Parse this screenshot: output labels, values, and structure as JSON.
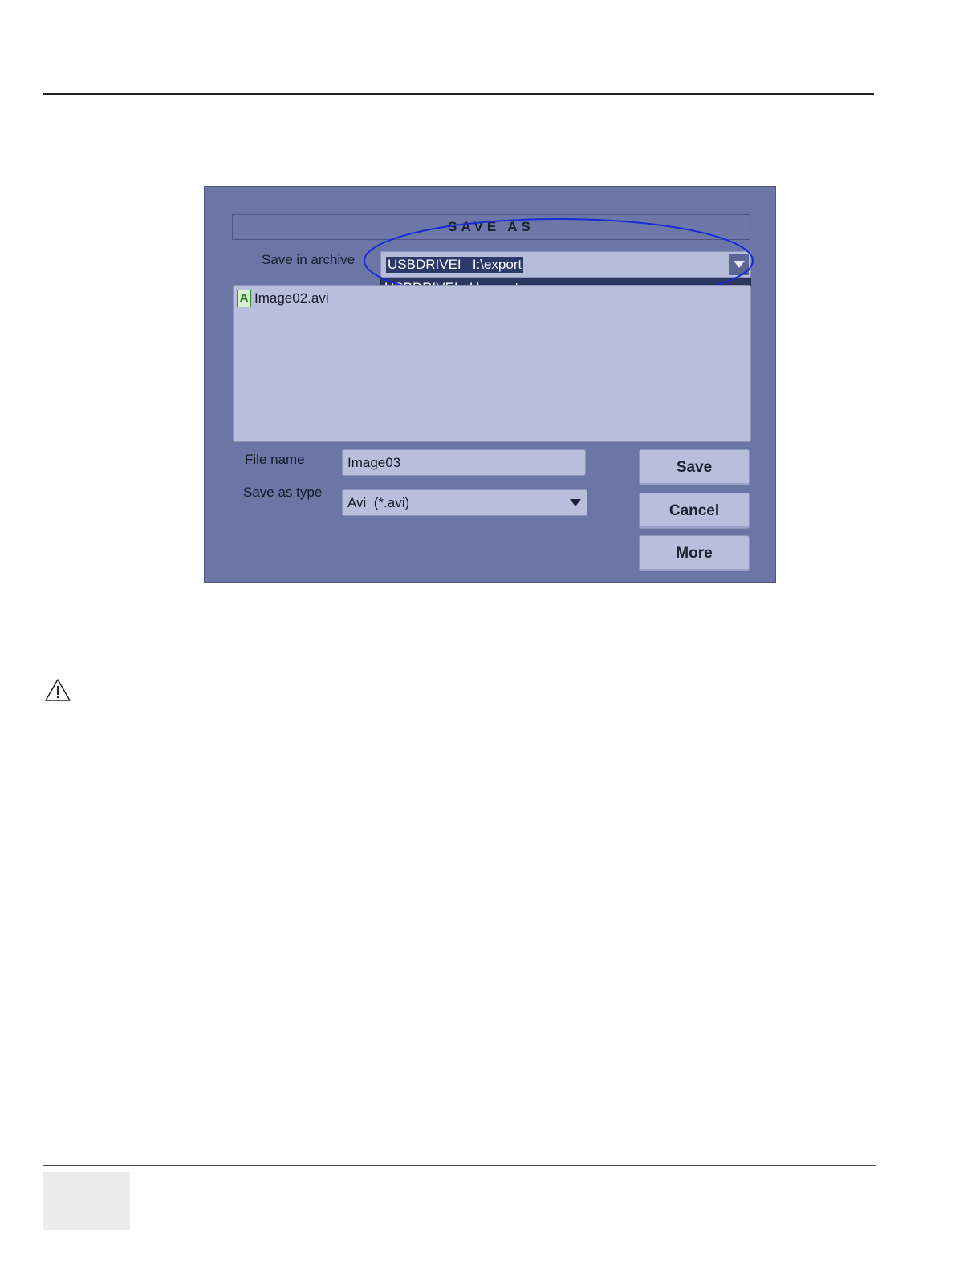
{
  "dialog": {
    "title": "SAVE AS",
    "archive_label": "Save in archive",
    "archive_selected": "USBDRIVEI   I:\\export",
    "archive_options": [
      "USBDRIVEI   I:\\export"
    ],
    "files": [
      {
        "icon": "A",
        "name": "Image02.avi"
      }
    ],
    "filename_label": "File name",
    "filename_value": "Image03",
    "type_label": "Save as type",
    "type_value": "Avi  (*.avi)",
    "buttons": {
      "save": "Save",
      "cancel": "Cancel",
      "more": "More"
    }
  },
  "colors": {
    "dialog_bg": "#6b76a6",
    "field_bg": "#b8bedb",
    "selection_bg": "#2b3a6a",
    "highlight_ellipse": "#1a2ad6"
  },
  "icons": [
    "chevron-down-icon",
    "avi-file-icon",
    "warning-icon"
  ]
}
